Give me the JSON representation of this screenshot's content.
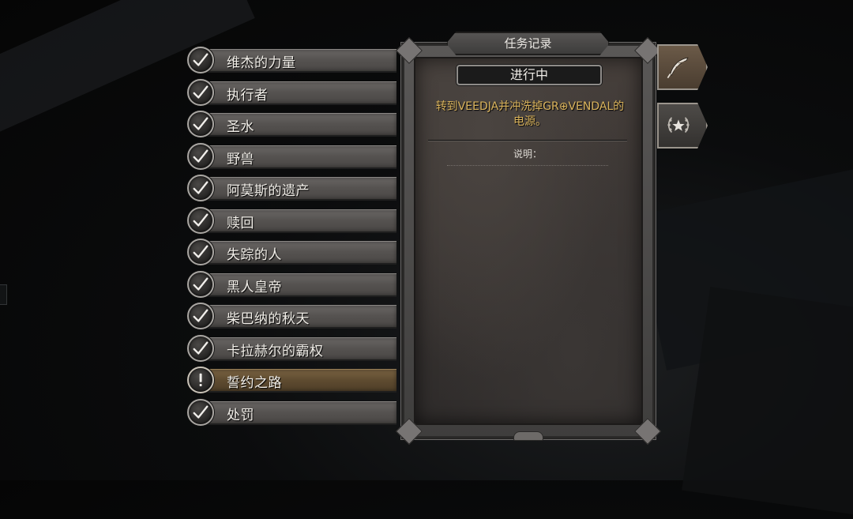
{
  "panel": {
    "title": "任务记录",
    "status_label": "进行中",
    "objective": "转到VEEDJA并冲洗掉GR⊕VENDAL的电源。",
    "description_label": "说明："
  },
  "quests": [
    {
      "label": "维杰的力量",
      "state": "completed"
    },
    {
      "label": "执行者",
      "state": "completed"
    },
    {
      "label": "圣水",
      "state": "completed"
    },
    {
      "label": "野兽",
      "state": "completed"
    },
    {
      "label": "阿莫斯的遗产",
      "state": "completed"
    },
    {
      "label": "赎回",
      "state": "completed"
    },
    {
      "label": "失踪的人",
      "state": "completed"
    },
    {
      "label": "黑人皇帝",
      "state": "completed"
    },
    {
      "label": "柴巴纳的秋天",
      "state": "completed"
    },
    {
      "label": "卡拉赫尔的霸权",
      "state": "completed"
    },
    {
      "label": "誓约之路",
      "state": "active"
    },
    {
      "label": "处罚",
      "state": "completed"
    }
  ],
  "side_tabs": [
    {
      "name": "quest-log",
      "icon": "feather-quill-icon",
      "selected": true
    },
    {
      "name": "achievements",
      "icon": "laurel-star-icon",
      "selected": false
    }
  ],
  "colors": {
    "objective_text": "#d9b35c",
    "active_row": "#5e4b30",
    "row": "#565351"
  }
}
